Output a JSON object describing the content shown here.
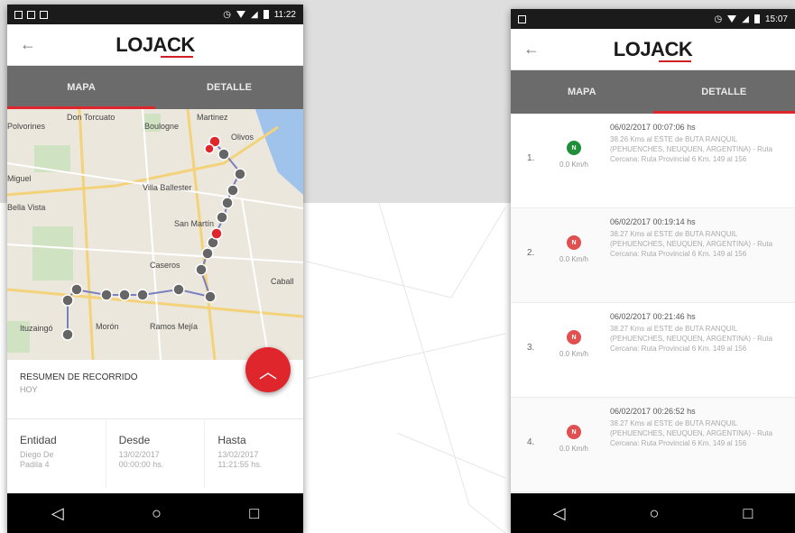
{
  "colors": {
    "accent": "#e0262d",
    "green": "#1f8f3a",
    "tabbar": "#6b6b6b"
  },
  "phone1": {
    "status": {
      "time": "11:22"
    },
    "logo": "LOJACK",
    "tabs": [
      {
        "label": "MAPA",
        "active": true
      },
      {
        "label": "DETALLE",
        "active": false
      }
    ],
    "map": {
      "labels": [
        "Don Torcuato",
        "Martinez",
        "Boulogne",
        "Olivos",
        "Polvorines",
        "Miguel",
        "Villa Ballester",
        "Bella Vista",
        "San Martín",
        "Caseros",
        "Caball",
        "Morón",
        "Ramos Mejía",
        "Ituzaingó"
      ]
    },
    "fab_icon": "chevron-up-icon",
    "summary": {
      "title": "RESUMEN DE RECORRIDO",
      "subtitle": "HOY"
    },
    "columns": [
      {
        "header": "Entidad",
        "value": "Diego De\nPadila 4"
      },
      {
        "header": "Desde",
        "value": "13/02/2017\n00:00:00 hs."
      },
      {
        "header": "Hasta",
        "value": "13/02/2017\n11:21:55 hs."
      }
    ],
    "nav": [
      "back-icon",
      "home-icon",
      "recents-icon"
    ]
  },
  "phone2": {
    "status": {
      "time": "15:07"
    },
    "logo": "LOJACK",
    "tabs": [
      {
        "label": "MAPA",
        "active": false
      },
      {
        "label": "DETALLE",
        "active": true
      }
    ],
    "rows": [
      {
        "num": "1.",
        "status": "green",
        "dot": "N",
        "speed": "0.0 Km/h",
        "datetime": "06/02/2017 00:07:06 hs",
        "address": "38.26 Kms al ESTE de BUTA RANQUIL (PEHUENCHES, NEUQUEN, ARGENTINA) - Ruta Cercana: Ruta Provincial 6 Km. 149 al 156"
      },
      {
        "num": "2.",
        "status": "red",
        "dot": "N",
        "speed": "0.0 Km/h",
        "datetime": "06/02/2017 00:19:14 hs",
        "address": "38.27 Kms al ESTE de BUTA RANQUIL (PEHUENCHES, NEUQUEN, ARGENTINA) - Ruta Cercana: Ruta Provincial 6 Km. 149 al 156"
      },
      {
        "num": "3.",
        "status": "red",
        "dot": "N",
        "speed": "0.0 Km/h",
        "datetime": "06/02/2017 00:21:46 hs",
        "address": "38.27 Kms al ESTE de BUTA RANQUIL (PEHUENCHES, NEUQUEN, ARGENTINA) - Ruta Cercana: Ruta Provincial 6 Km. 149 al 156"
      },
      {
        "num": "4.",
        "status": "red",
        "dot": "N",
        "speed": "0.0 Km/h",
        "datetime": "06/02/2017 00:26:52 hs",
        "address": "38.27 Kms al ESTE de BUTA RANQUIL (PEHUENCHES, NEUQUEN, ARGENTINA) - Ruta Cercana: Ruta Provincial 6 Km. 149 al 156"
      }
    ],
    "nav": [
      "back-icon",
      "home-icon",
      "recents-icon"
    ]
  }
}
